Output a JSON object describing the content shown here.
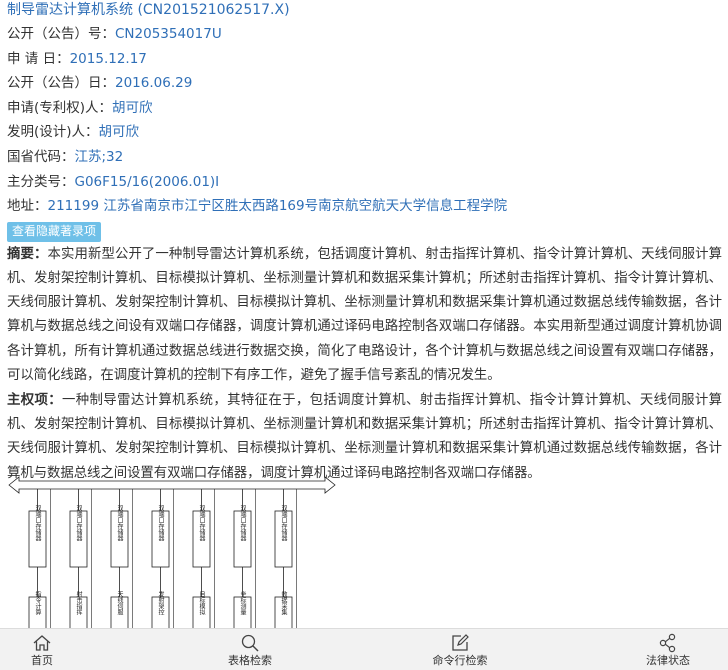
{
  "patent": {
    "title": "制导雷达计算机系统 (CN201521062517.X)",
    "pub_no_label": "公开（公告）号：",
    "pub_no": "CN205354017U",
    "app_date_label": "申 请 日：",
    "app_date": "2015.12.17",
    "pub_date_label": "公开（公告）日：",
    "pub_date": "2016.06.29",
    "applicant_label": "申请(专利权)人：",
    "applicant": "胡可欣",
    "inventor_label": "发明(设计)人：",
    "inventor": "胡可欣",
    "province_label": "国省代码：",
    "province": "江苏;32",
    "ipc_label": "主分类号：",
    "ipc": "G06F15/16(2006.01)I",
    "address_label": "地址：",
    "address": "211199 江苏省南京市江宁区胜太西路169号南京航空航天大学信息工程学院",
    "hidden_button": "查看隐藏著录项",
    "abstract_label": "摘要：",
    "abstract": "本实用新型公开了一种制导雷达计算机系统，包括调度计算机、射击指挥计算机、指令计算计算机、天线伺服计算机、发射架控制计算机、目标模拟计算机、坐标测量计算机和数据采集计算机；所述射击指挥计算机、指令计算计算机、天线伺服计算机、发射架控制计算机、目标模拟计算机、坐标测量计算机和数据采集计算机通过数据总线传输数据，各计算机与数据总线之间设有双端口存储器，调度计算机通过译码电路控制各双端口存储器。本实用新型通过调度计算机协调各计算机，所有计算机通过数据总线进行数据交换，简化了电路设计，各个计算机与数据总线之间设置有双端口存储器，可以简化线路，在调度计算机的控制下有序工作，避免了握手信号紊乱的情况发生。",
    "claim_label": "主权项：",
    "claim": "一种制导雷达计算机系统，其特征在于，包括调度计算机、射击指挥计算机、指令计算计算机、天线伺服计算机、发射架控制计算机、目标模拟计算机、坐标测量计算机和数据采集计算机；所述射击指挥计算机、指令计算计算机、天线伺服计算机、发射架控制计算机、目标模拟计算机、坐标测量计算机和数据采集计算机通过数据总线传输数据，各计算机与数据总线之间设置有双端口存储器，调度计算机通过译码电路控制各双端口存储器。"
  },
  "drawing": {
    "memory_labels": [
      "双端口存储器",
      "双端口存储器",
      "双端口存储器",
      "双端口存储器",
      "双端口存储器",
      "双端口存储器",
      "双端口存储器"
    ],
    "computer_labels": [
      "指令计算",
      "射击指挥",
      "天线伺服",
      "发射架控",
      "目标模拟",
      "坐标测量",
      "数据采集"
    ]
  },
  "nav": {
    "items": [
      {
        "label": "首页",
        "icon": "home-icon"
      },
      {
        "label": "表格检索",
        "icon": "search-icon"
      },
      {
        "label": "命令行检索",
        "icon": "edit-icon"
      },
      {
        "label": "法律状态",
        "icon": "share-icon"
      }
    ]
  }
}
